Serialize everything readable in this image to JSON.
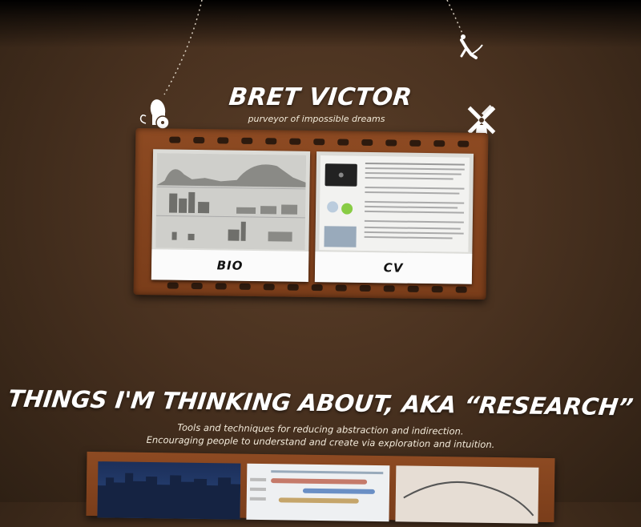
{
  "header": {
    "title": "BRET VICTOR",
    "tagline": "purveyor of impossible dreams"
  },
  "portfolio": {
    "frames": [
      {
        "label": "BIO",
        "thumbnail": "bio-chart-thumbnail"
      },
      {
        "label": "CV",
        "thumbnail": "cv-document-thumbnail"
      }
    ]
  },
  "research": {
    "title": "THINGS I'M THINKING ABOUT, AKA “RESEARCH”",
    "line1": "Tools and techniques for reducing abstraction and indirection.",
    "line2": "Encouraging people to understand and create via exploration and intuition."
  },
  "icons": [
    "cannon-icon",
    "windmill-icon",
    "acrobat-icon"
  ],
  "colors": {
    "background": "#4a3220",
    "film": "#8d4a22",
    "sprocket": "#2d1a0e",
    "text": "#ffffff"
  }
}
